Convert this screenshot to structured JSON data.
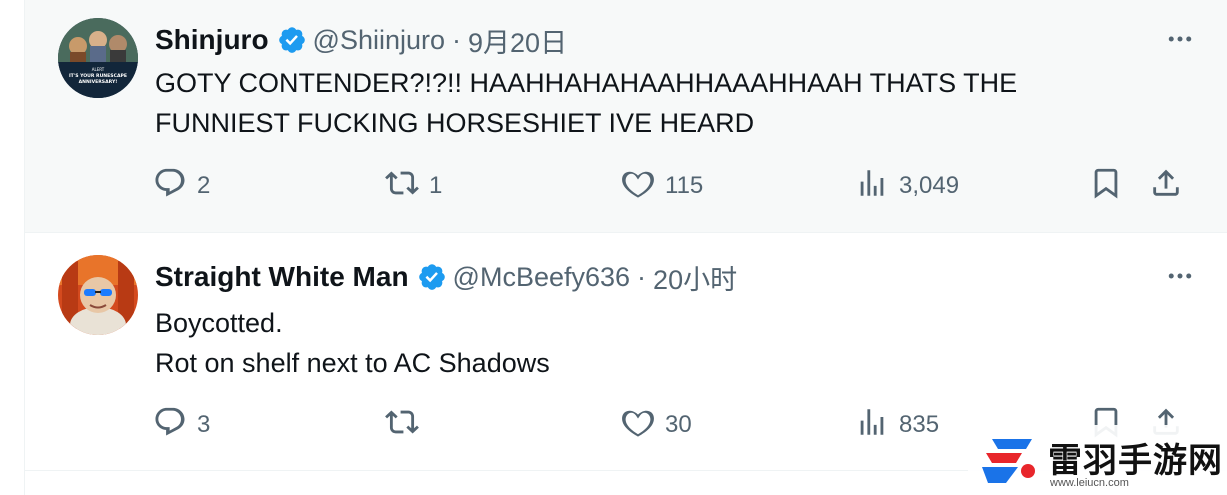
{
  "tweets": [
    {
      "display_name": "Shinjuro",
      "handle": "@Shiinjuro",
      "separator": "·",
      "time": "9月20日",
      "text_lines": [
        "GOTY  CONTENDER?!?!! HAAHHAHAHAAHHAAAHHAAH THATS THE",
        "FUNNIEST FUCKING HORSESHIET IVE HEARD"
      ],
      "avatar_caption": [
        "ALERT",
        "IT'S YOUR RUNESCAPE",
        "ANNIVERSARY!"
      ],
      "verified_icon": "verified-badge-icon",
      "replies": "2",
      "retweets": "1",
      "likes": "115",
      "views": "3,049"
    },
    {
      "display_name": "Straight White Man",
      "handle": "@McBeefy636",
      "separator": "·",
      "time": "20小时",
      "text_lines": [
        "Boycotted.",
        "Rot on shelf next to AC Shadows"
      ],
      "verified_icon": "verified-badge-icon",
      "replies": "3",
      "retweets": "",
      "likes": "30",
      "views": "835"
    }
  ],
  "watermark": {
    "text": "雷羽手游网",
    "url": "www.leiucn.com"
  },
  "colors": {
    "text_primary": "#0f1419",
    "text_secondary": "#536471",
    "verified_blue": "#1d9bf0",
    "highlight_bg": "#f7f9f9",
    "watermark_blue": "#1a73e8",
    "watermark_red": "#e8262b"
  },
  "icons": [
    "more-icon",
    "reply-icon",
    "retweet-icon",
    "like-icon",
    "views-icon",
    "bookmark-icon",
    "share-icon"
  ]
}
